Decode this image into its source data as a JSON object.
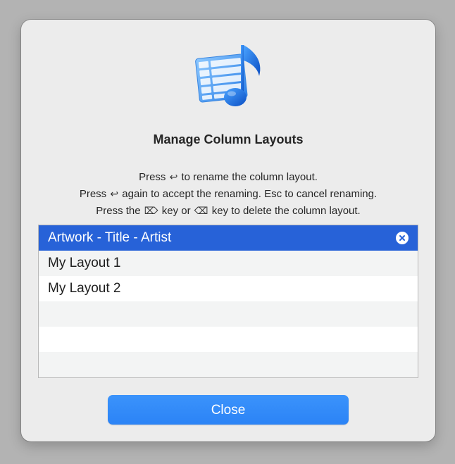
{
  "dialog": {
    "title": "Manage Column Layouts",
    "icon": "music-table-app-icon",
    "instructions": {
      "line1_before": "Press",
      "line1_after": "to rename the column layout.",
      "line2_before": "Press",
      "line2_after": "again to accept the renaming. Esc to cancel renaming.",
      "line3_before": "Press the",
      "line3_middle": "key or",
      "line3_after": "key to delete the column layout."
    },
    "key_glyphs": {
      "return": "↩",
      "forward_delete": "⌦",
      "delete": "⌫"
    }
  },
  "layouts": {
    "items": [
      {
        "label": "Artwork - Title - Artist",
        "selected": true
      },
      {
        "label": "My Layout 1",
        "selected": false
      },
      {
        "label": "My Layout 2",
        "selected": false
      }
    ],
    "empty_rows": 3
  },
  "buttons": {
    "close_label": "Close"
  },
  "colors": {
    "accent": "#2b83f6",
    "selection": "#2762d8",
    "dialog_background": "#ececec",
    "alternate_row": "#f3f4f4"
  }
}
